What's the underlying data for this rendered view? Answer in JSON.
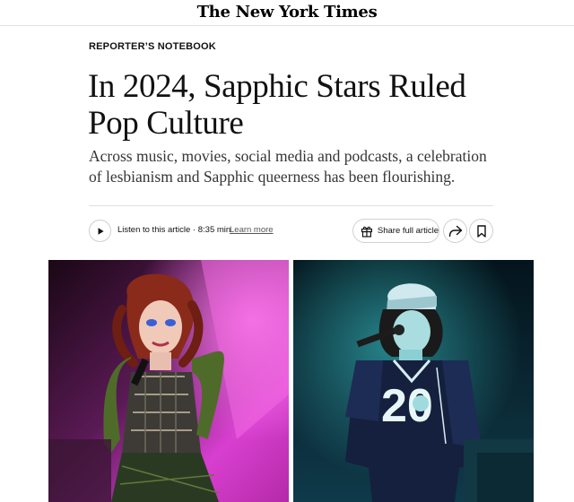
{
  "masthead": {
    "logo": "The New York Times"
  },
  "article": {
    "kicker": "REPORTER’S NOTEBOOK",
    "headline": "In 2024, Sapphic Stars Ruled Pop Culture",
    "summary": "Across music, movies, social media and podcasts, a celebration of lesbianism and Sapphic queerness has been flourishing."
  },
  "toolbar": {
    "listen_label": "Listen to this article · 8:35 min",
    "learn_more": "Learn more",
    "share_label": "Share full article",
    "icons": [
      "play-icon",
      "gift-icon",
      "share-arrow-icon",
      "bookmark-icon"
    ]
  },
  "photos": {
    "left_description_color": "#d83fd0",
    "right_description_color": "#0f3a4a"
  }
}
